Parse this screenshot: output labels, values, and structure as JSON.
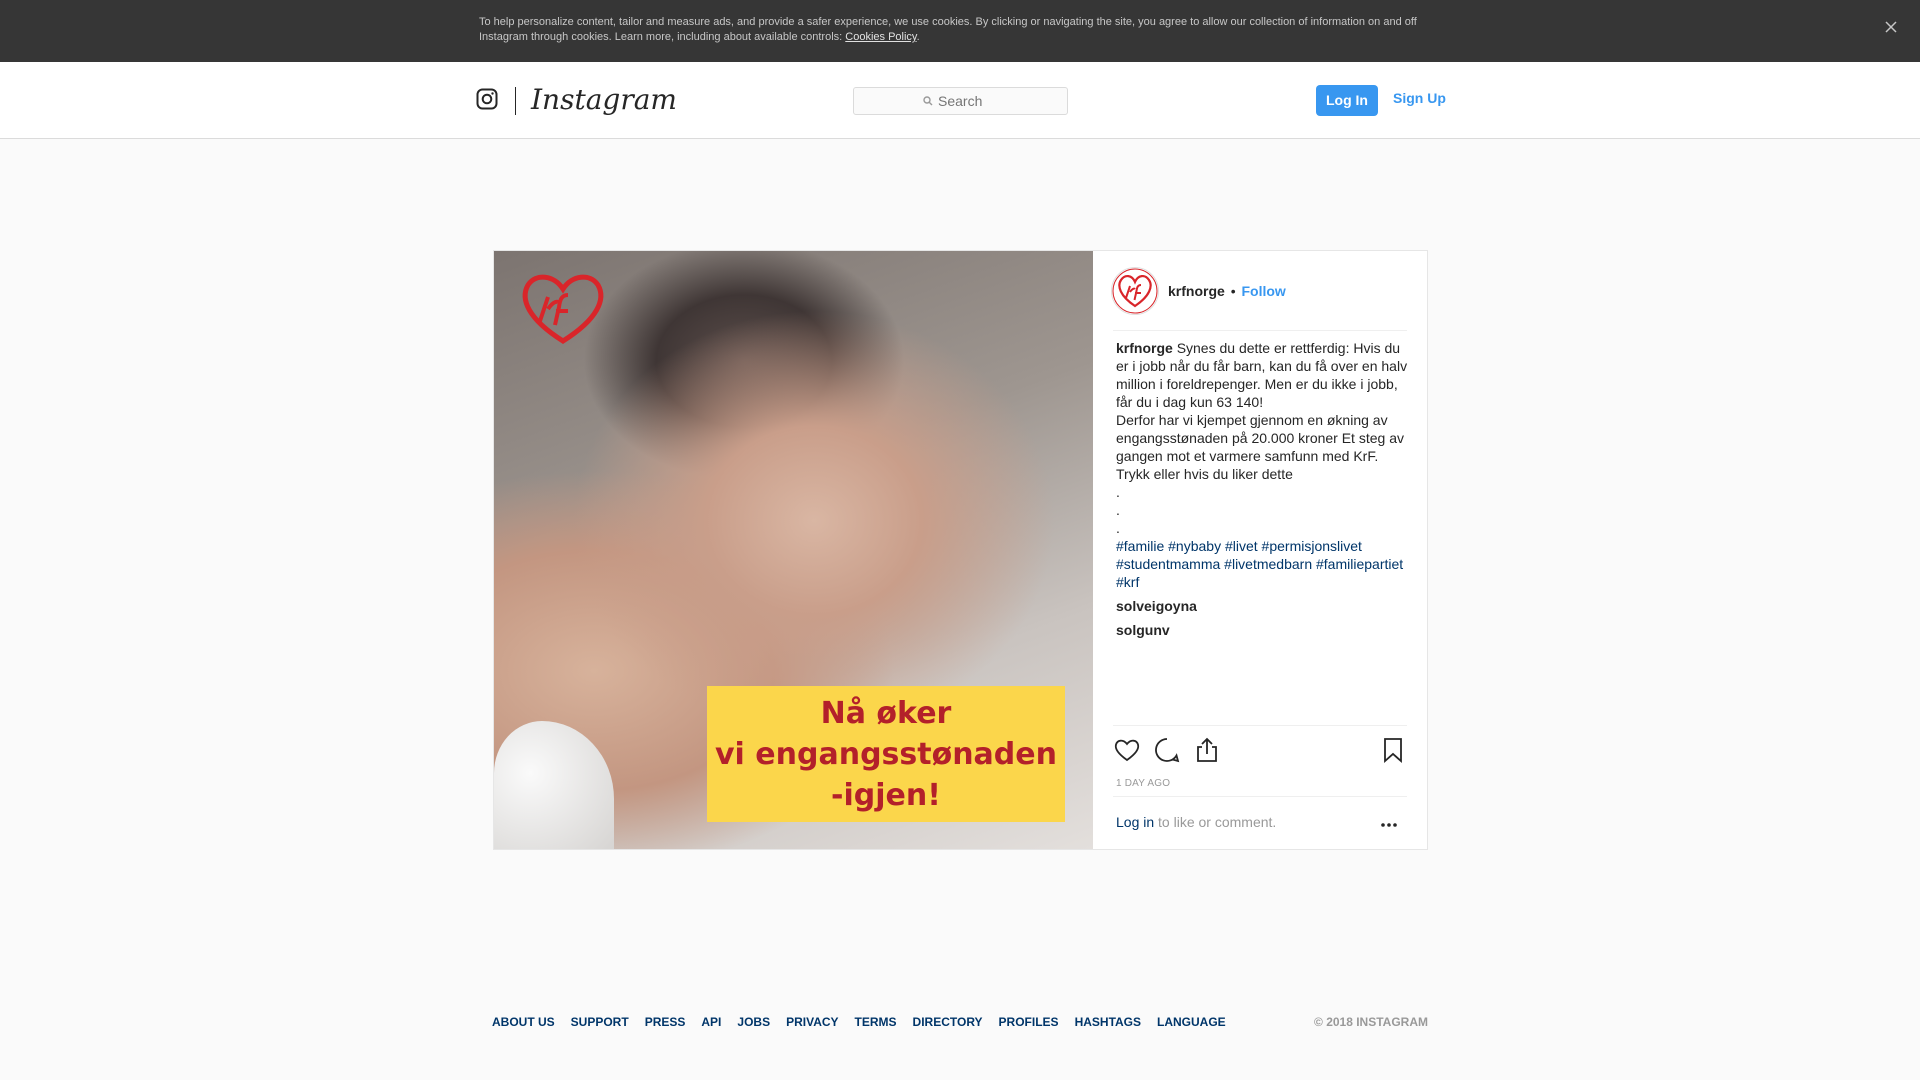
{
  "cookie_banner": {
    "text": "To help personalize content, tailor and measure ads, and provide a safer experience, we use cookies. By clicking or navigating the site, you agree to allow our collection of information on and off Instagram through cookies. Learn more, including about available controls: ",
    "link": "Cookies Policy",
    "link_suffix": ".",
    "close_icon": "close-icon"
  },
  "header": {
    "wordmark": "Instagram",
    "search_placeholder": "Search",
    "login_label": "Log In",
    "signup_label": "Sign Up"
  },
  "post": {
    "username": "krfnorge",
    "separator": "•",
    "follow_label": "Follow",
    "image_text_line1": "Nå øker",
    "image_text_line2": "vi engangsstønaden",
    "image_text_line3": "-igjen!",
    "caption_user": "krfnorge",
    "caption_line1": "Synes du dette er rettferdig: Hvis du er i jobb når du får barn, kan du få over en halv million i foreldrepenger. Men er du ikke i jobb, får du i dag kun 63 140! ",
    "caption_line2": "Derfor har vi kjempet gjennom en økning av engangsstønaden på 20.000 kroner  Et steg av gangen mot et varmere samfunn med KrF.",
    "caption_line3": "Trykk  eller  hvis du liker dette ",
    "dot1": ".",
    "dot2": ".",
    "dot3": ".",
    "hashtags": [
      "#familie",
      "#nybaby",
      "#livet",
      "#permisjonslivet",
      "#studentmamma",
      "#livetmedbarn",
      "#familiepartiet",
      "#krf"
    ],
    "comments": [
      {
        "user": "solveigoyna",
        "text": ""
      },
      {
        "user": "solgunv",
        "text": ""
      }
    ],
    "timestamp": "1 DAY AGO",
    "login_link": "Log in",
    "login_suffix": " to like or comment."
  },
  "footer": {
    "links": [
      "ABOUT US",
      "SUPPORT",
      "PRESS",
      "API",
      "JOBS",
      "PRIVACY",
      "TERMS",
      "DIRECTORY",
      "PROFILES",
      "HASHTAGS",
      "LANGUAGE"
    ],
    "copyright": "© 2018 INSTAGRAM"
  },
  "colors": {
    "accent": "#3897f0",
    "link_dark": "#003569",
    "brand_red": "#b3202a",
    "banner_yellow": "#fbd64b"
  }
}
